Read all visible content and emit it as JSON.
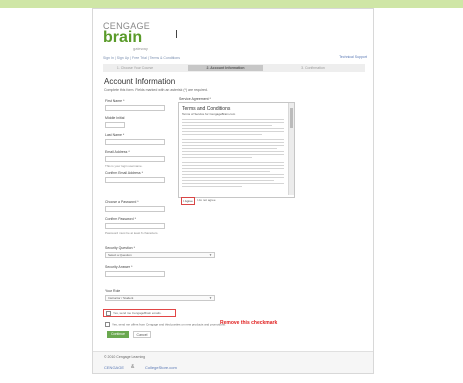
{
  "header": {
    "logo_top": "CENGAGE",
    "logo_main": "brain",
    "logo_sub": "gateway",
    "breadcrumb": "Sign In  |  Sign Up  |  Free Trial  |  Terms & Conditions",
    "help_link": "Technical Support"
  },
  "steps": [
    {
      "label": "1. Choose Your Course"
    },
    {
      "label": "2. Account Information"
    },
    {
      "label": "3. Confirmation"
    }
  ],
  "form": {
    "title": "Account Information",
    "subtitle": "Complete this form. Fields marked with an asterisk (*) are required.",
    "first_name_label": "First Name *",
    "middle_initial_label": "Middle Initial",
    "last_name_label": "Last Name *",
    "email_label": "Email Address *",
    "email_hint": "This is your login username.",
    "confirm_email_label": "Confirm Email Address *",
    "password_label": "Choose a Password *",
    "confirm_password_label": "Confirm Password *",
    "password_hint": "Password must be at least 6 characters.",
    "security_question_label": "Security Question *",
    "security_question_value": "Select a Question",
    "security_answer_label": "Security Answer *",
    "role_label": "Your Role",
    "role_value": "Instructor / Student",
    "checkbox_text": "Yes, send me CengageBrain emails.",
    "optin_text": "Yes, send me offers from Cengage and third parties on new products and promotions.",
    "continue_label": "Continue",
    "cancel_label": "Cancel"
  },
  "agreement": {
    "label": "Service Agreement *",
    "title": "Terms and Conditions",
    "subtitle": "Terms of Service for CengageBrain.com",
    "agree_button": "I Agree",
    "agree_text": "I do not agree"
  },
  "annotation": "Remove this checkmark",
  "footer": {
    "copyright": "© 2010 Cengage Learning",
    "logo_cengage": "CENGAGE",
    "logo_ampersand": "&",
    "logo_partner": "CollegeStore.com"
  }
}
